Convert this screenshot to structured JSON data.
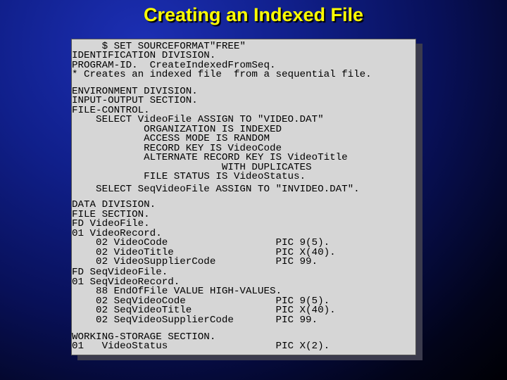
{
  "slide": {
    "title": "Creating an Indexed File"
  },
  "code": {
    "lines": [
      "     $ SET SOURCEFORMAT\"FREE\"",
      "IDENTIFICATION DIVISION.",
      "PROGRAM-ID.  CreateIndexedFromSeq.",
      "* Creates an indexed file  from a sequential file.",
      "ENVIRONMENT DIVISION.",
      "INPUT-OUTPUT SECTION.",
      "FILE-CONTROL.",
      "    SELECT VideoFile ASSIGN TO \"VIDEO.DAT\"",
      "            ORGANIZATION IS INDEXED",
      "            ACCESS MODE IS RANDOM",
      "            RECORD KEY IS VideoCode",
      "            ALTERNATE RECORD KEY IS VideoTitle",
      "                         WITH DUPLICATES",
      "            FILE STATUS IS VideoStatus.",
      "    SELECT SeqVideoFile ASSIGN TO \"INVIDEO.DAT\".",
      "DATA DIVISION.",
      "FILE SECTION.",
      "FD VideoFile.",
      "01 VideoRecord.",
      "    02 VideoCode                  PIC 9(5).",
      "    02 VideoTitle                 PIC X(40).",
      "    02 VideoSupplierCode          PIC 99.",
      "FD SeqVideoFile.",
      "01 SeqVideoRecord.",
      "    88 EndOfFile VALUE HIGH-VALUES.",
      "    02 SeqVideoCode               PIC 9(5).",
      "    02 SeqVideoTitle              PIC X(40).",
      "    02 SeqVideoSupplierCode       PIC 99.",
      "WORKING-STORAGE SECTION.",
      "01   VideoStatus                  PIC X(2)."
    ]
  }
}
